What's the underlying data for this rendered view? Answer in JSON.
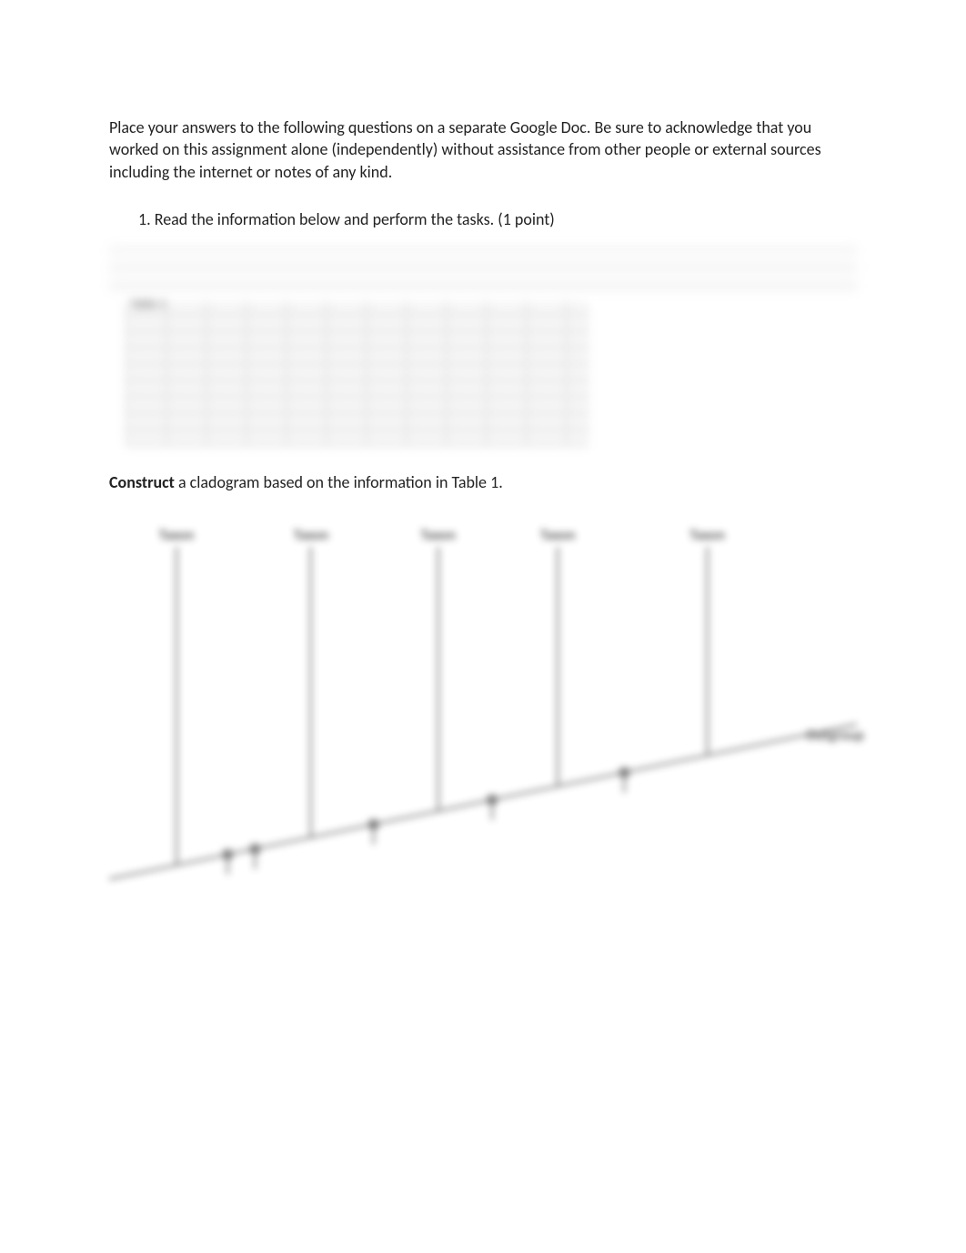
{
  "intro": "Place your answers to the following questions on a separate Google Doc. Be sure to acknowledge that you worked on this assignment alone (independently) without assistance from other people or external sources including the internet or notes of any kind.",
  "item1": "1. Read the information below and perform the tasks. (1 point)",
  "table_caption": "Table 1",
  "construct_bold": "Construct",
  "construct_rest": " a cladogram based on the information in Table 1.",
  "clad": {
    "taxon1": "Taxon",
    "taxon2": "Taxon",
    "taxon3": "Taxon",
    "taxon4": "Taxon",
    "taxon5": "Taxon",
    "outgroup": "Outgroup"
  }
}
